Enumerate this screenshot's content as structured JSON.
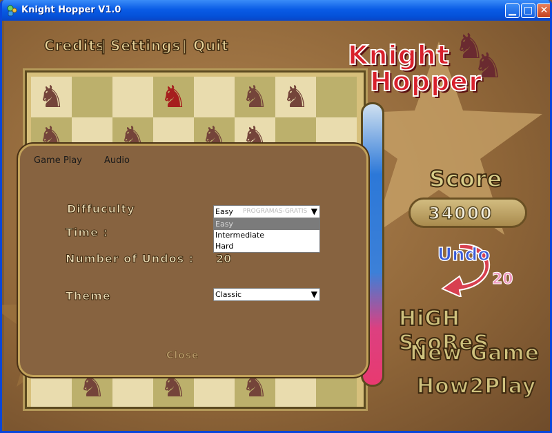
{
  "window": {
    "title": "Knight Hopper V1.0"
  },
  "menu": {
    "credits": "Credits",
    "settings": "Settings",
    "quit": "Quit",
    "sep": "|"
  },
  "logo": {
    "line1": "Knight",
    "line2": "Hopper"
  },
  "dialog": {
    "tabs": [
      "Game Play",
      "Audio"
    ],
    "difficulty_label": "Diffuculty",
    "difficulty_value": "Easy",
    "difficulty_options": [
      "Easy",
      "Intermediate",
      "Hard"
    ],
    "time_label": "Time :",
    "undos_label": "Number of Undos :",
    "undos_value": "20",
    "theme_label": "Theme",
    "theme_value": "Classic",
    "close_label": "Close",
    "watermark": "PROGRAMAS-GRATIS"
  },
  "score": {
    "label": "Score",
    "value": "34000"
  },
  "undo": {
    "label": "Undo",
    "count": "20"
  },
  "buttons": {
    "high_scores": "HiGH ScoReS",
    "new_game": "New Game",
    "how2play": "How2Play"
  },
  "colors": {
    "accent": "#d8202c",
    "board_light": "#e9dcae",
    "board_dark": "#bcb06c",
    "piece": "#74443a",
    "piece_selected": "#a61e1e"
  }
}
